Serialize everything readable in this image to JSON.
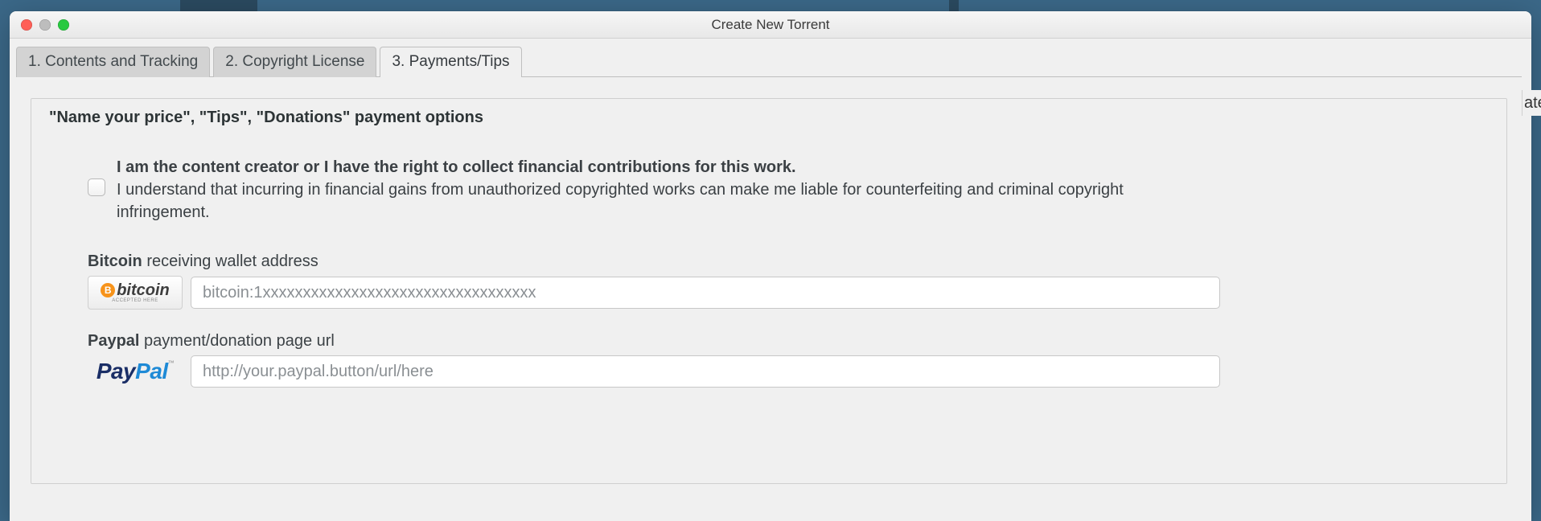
{
  "window": {
    "title": "Create New Torrent"
  },
  "tabs": [
    {
      "label": "1. Contents and Tracking",
      "active": false
    },
    {
      "label": "2. Copyright License",
      "active": false
    },
    {
      "label": "3. Payments/Tips",
      "active": true
    }
  ],
  "section": {
    "title": "\"Name your price\", \"Tips\", \"Donations\" payment options"
  },
  "consent": {
    "bold": "I am the content creator or I have the right to collect financial contributions for this work.",
    "body": "I understand that incurring in financial gains from unauthorized copyrighted works can make me liable for counterfeiting and criminal copyright infringement.",
    "checked": false
  },
  "bitcoin": {
    "label_bold": "Bitcoin",
    "label_rest": " receiving wallet address",
    "placeholder": "bitcoin:1xxxxxxxxxxxxxxxxxxxxxxxxxxxxxxxxxx",
    "value": "",
    "badge_sub": "ACCEPTED HERE"
  },
  "paypal": {
    "label_bold": "Paypal",
    "label_rest": " payment/donation page url",
    "placeholder": "http://your.paypal.button/url/here",
    "value": ""
  },
  "sliver": "ate"
}
